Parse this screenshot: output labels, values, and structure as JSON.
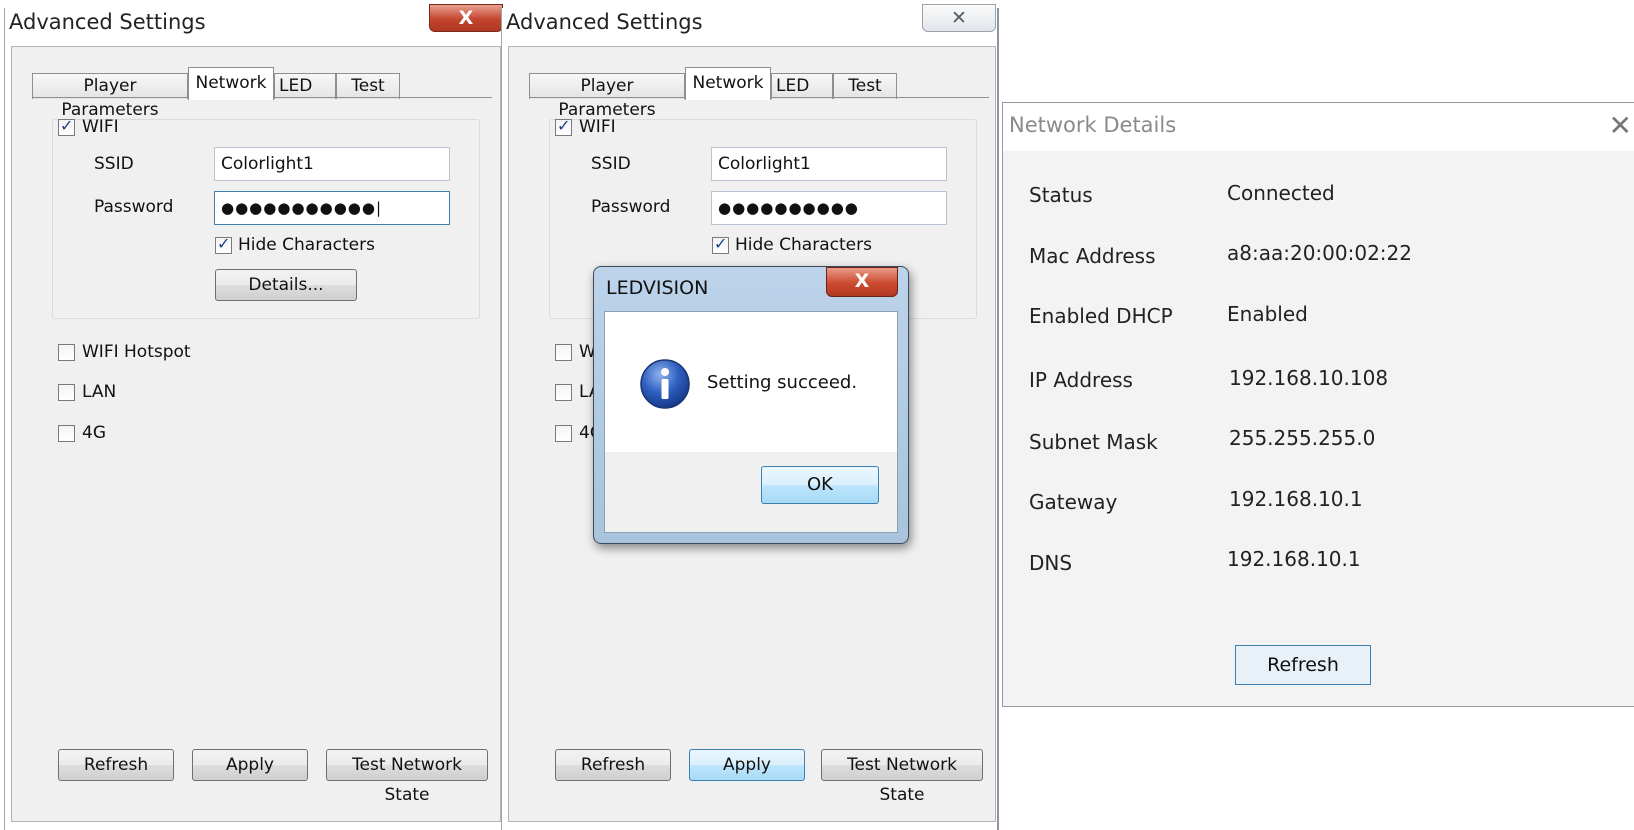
{
  "left_window": {
    "title": "Advanced Settings",
    "close_glyph": "X",
    "tabs": [
      "Player Parameters",
      "Network",
      "LED",
      "Test"
    ],
    "wifi_label": "WIFI",
    "ssid_label": "SSID",
    "ssid_value": "Colorlight1",
    "password_label": "Password",
    "password_value": "●●●●●●●●●●●|",
    "hide_chars_label": "Hide Characters",
    "details_button": "Details...",
    "hotspot_label": "WIFI Hotspot",
    "lan_label": "LAN",
    "g4_label": "4G",
    "refresh_button": "Refresh",
    "apply_button": "Apply",
    "test_button": "Test Network State"
  },
  "right_window": {
    "title": "Advanced Settings",
    "close_glyph": "✕",
    "tabs": [
      "Player Parameters",
      "Network",
      "LED",
      "Test"
    ],
    "wifi_label": "WIFI",
    "ssid_label": "SSID",
    "ssid_value": "Colorlight1",
    "password_label": "Password",
    "password_value": "●●●●●●●●●●",
    "hide_chars_label": "Hide Characters",
    "hotspot_label_partial": "W",
    "lan_label_partial": "LA",
    "g4_label_partial": "4G",
    "refresh_button": "Refresh",
    "apply_button": "Apply",
    "test_button": "Test Network State"
  },
  "dialog": {
    "title": "LEDVISION",
    "close_glyph": "X",
    "icon": "info-icon",
    "message": "Setting succeed.",
    "ok_button": "OK"
  },
  "network_details": {
    "title": "Network Details",
    "close_glyph": "✕",
    "rows": [
      {
        "label": "Status",
        "value": "Connected"
      },
      {
        "label": "Mac Address",
        "value": "a8:aa:20:00:02:22"
      },
      {
        "label": "Enabled DHCP",
        "value": "Enabled"
      },
      {
        "label": "IP Address",
        "value": "192.168.10.108"
      },
      {
        "label": "Subnet Mask",
        "value": "255.255.255.0"
      },
      {
        "label": "Gateway",
        "value": "192.168.10.1"
      },
      {
        "label": "DNS",
        "value": "192.168.10.1"
      }
    ],
    "refresh_button": "Refresh"
  },
  "colors": {
    "close_red": "#c4452e",
    "button_focus_blue": "#3c7fb1",
    "dialog_frame": "#a9c3dd",
    "info_icon_blue": "#1f4fa8"
  }
}
